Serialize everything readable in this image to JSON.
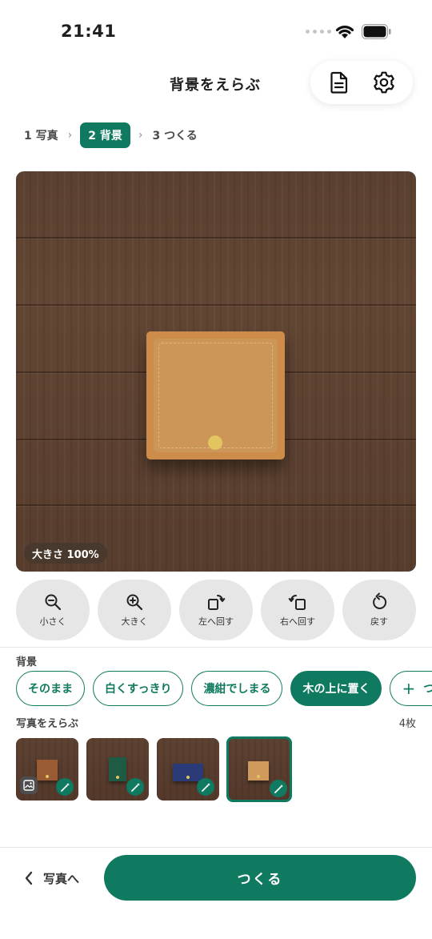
{
  "status_bar": {
    "time": "21:41"
  },
  "header": {
    "title": "背景をえらぶ",
    "doc_icon": "document-icon",
    "settings_icon": "gear-icon"
  },
  "stepper": {
    "steps": [
      {
        "label": "1 写真",
        "active": false
      },
      {
        "label": "2 背景",
        "active": true
      },
      {
        "label": "3 つくる",
        "active": false
      }
    ]
  },
  "preview": {
    "size_label": "大きさ 100%",
    "background": "wood"
  },
  "tools": [
    {
      "label": "小さく",
      "icon": "zoom-out-icon"
    },
    {
      "label": "大きく",
      "icon": "zoom-in-icon"
    },
    {
      "label": "左へ回す",
      "icon": "rotate-left-icon"
    },
    {
      "label": "右へ回す",
      "icon": "rotate-right-icon"
    },
    {
      "label": "戻す",
      "icon": "undo-icon"
    }
  ],
  "background_section": {
    "label": "背景",
    "options": [
      {
        "label": "そのまま",
        "selected": false
      },
      {
        "label": "白くすっきり",
        "selected": false
      },
      {
        "label": "濃紺でしまる",
        "selected": false
      },
      {
        "label": "木の上に置く",
        "selected": true
      },
      {
        "label": "つく",
        "selected": false,
        "plus": true
      }
    ]
  },
  "photos_section": {
    "label": "写真をえらぶ",
    "count": "4枚",
    "photos": [
      {
        "color": "#9a5a33",
        "selected": false,
        "has_image_badge": true
      },
      {
        "color": "#1f5a44",
        "selected": false,
        "has_image_badge": false
      },
      {
        "color": "#2a3b78",
        "selected": false,
        "has_image_badge": false
      },
      {
        "color": "#cf9a5c",
        "selected": true,
        "has_image_badge": false
      }
    ]
  },
  "footer": {
    "back_label": "写真へ",
    "primary_label": "つくる"
  },
  "colors": {
    "accent": "#0f7a5f",
    "wood": "#5d4231"
  }
}
